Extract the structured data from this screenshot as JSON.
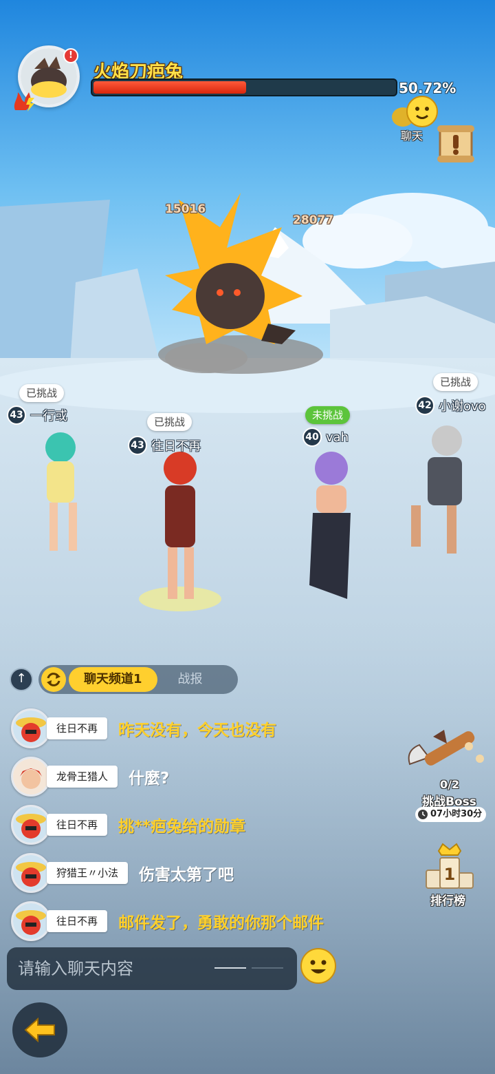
{
  "boss": {
    "name": "火焰刀疤兔",
    "hp_percent_text": "50.72%",
    "hp_fraction": 0.5072
  },
  "top_right": {
    "chat_label": "聊天"
  },
  "damage_numbers": [
    "15016",
    "28077"
  ],
  "players": [
    {
      "status": "已挑战",
      "level": "43",
      "name": "一行或"
    },
    {
      "status": "已挑战",
      "level": "43",
      "name": "往日不再"
    },
    {
      "status": "未挑战",
      "level": "40",
      "name": "vah"
    },
    {
      "status": "已挑战",
      "level": "42",
      "name": "小谢ovo"
    }
  ],
  "chat": {
    "expand_icon": "arrow-up-icon",
    "tabs": [
      {
        "label": "聊天频道1",
        "active": true
      },
      {
        "label": "战报",
        "active": false
      }
    ],
    "messages": [
      {
        "sender": "往日不再",
        "text": "昨天没有，今天也没有",
        "color": "#ffd02a"
      },
      {
        "sender": "龙骨王猎人",
        "text": "什麼?",
        "color": "#ffffff"
      },
      {
        "sender": "往日不再",
        "text": "挑**疤兔给的勋章",
        "color": "#ffd02a"
      },
      {
        "sender": "狩猎王〃小法",
        "text": "伤害太第了吧",
        "color": "#ffffff"
      },
      {
        "sender": "往日不再",
        "text": "邮件发了，勇敢的你那个邮件",
        "color": "#ffd02a"
      }
    ],
    "input_placeholder": "请输入聊天内容"
  },
  "boss_challenge": {
    "count": "0/2",
    "label": "挑战Boss",
    "timer": "07小时30分"
  },
  "ranking": {
    "label": "排行榜",
    "rank_digit": "1"
  },
  "colors": {
    "accent_yellow": "#ffcf2e",
    "hp_red": "#e8341a",
    "sky_top": "#2f8fe0"
  }
}
